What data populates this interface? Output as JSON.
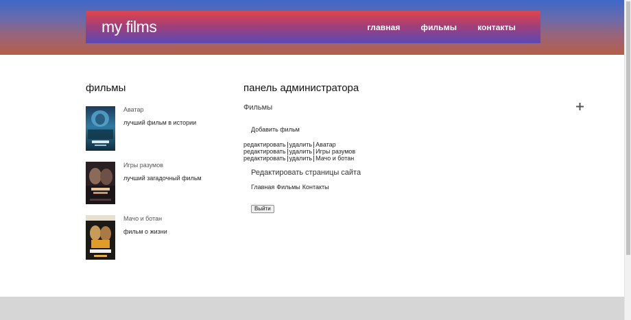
{
  "header": {
    "logo": "my films",
    "nav": [
      "главная",
      "фильмы",
      "контакты"
    ]
  },
  "films_section": {
    "title": "фильмы",
    "films": [
      {
        "title": "Аватар",
        "description": "лучший фильм в истории"
      },
      {
        "title": "Игры разумов",
        "description": "лучший загадочный фильм"
      },
      {
        "title": "Мачо и ботан",
        "description": "фильм о жизни"
      }
    ]
  },
  "admin": {
    "title": "панель администратора",
    "films_label": "Фильмы",
    "add_film": "Добавить фильм",
    "edit_label": "редактировать",
    "delete_label": "удалить",
    "film_rows": [
      "Аватар",
      "Игры разумов",
      "Мачо и ботан"
    ],
    "edit_site_title": "Редактировать страницы сайта",
    "site_pages": [
      "Главная",
      "Фильмы",
      "Контакты"
    ],
    "logout": "Выйти"
  },
  "colors": {
    "header_top": "#e0454c",
    "header_bottom": "#5a49b7",
    "band_top": "#3e68c8",
    "band_bottom": "#b45f48",
    "footer": "#d6d6d6"
  },
  "icons": {
    "plus": "plus-icon"
  }
}
